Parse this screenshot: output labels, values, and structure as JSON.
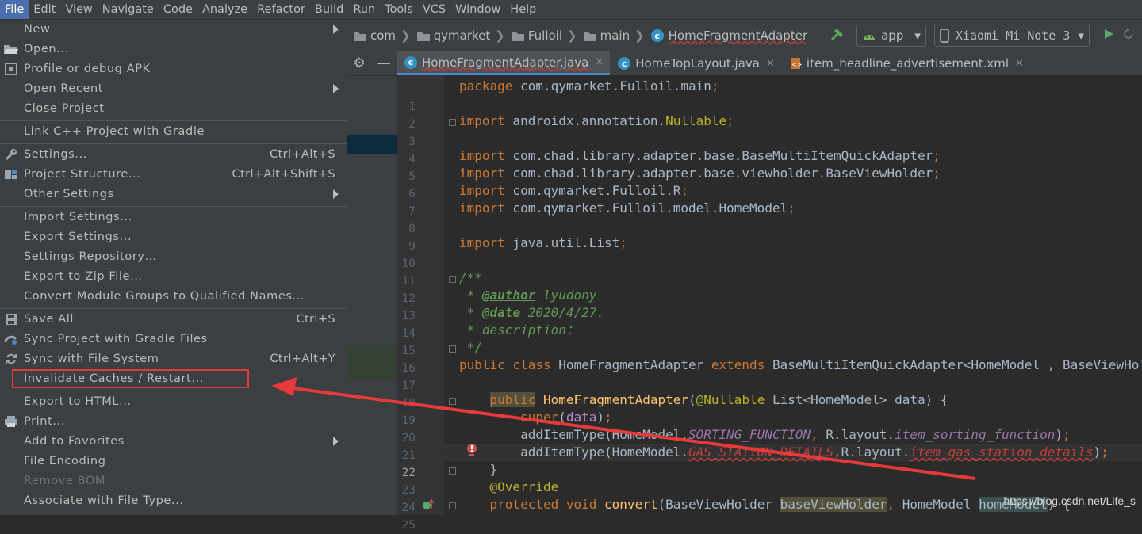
{
  "menubar": {
    "items": [
      "File",
      "Edit",
      "View",
      "Navigate",
      "Code",
      "Analyze",
      "Refactor",
      "Build",
      "Run",
      "Tools",
      "VCS",
      "Window",
      "Help"
    ],
    "active": "File"
  },
  "file_menu": {
    "items": [
      {
        "label": "New",
        "icon": "",
        "shortcut": "",
        "submenu": true
      },
      {
        "label": "Open...",
        "icon": "folder-icon",
        "shortcut": "",
        "submenu": false
      },
      {
        "label": "Profile or debug APK",
        "icon": "apk-icon",
        "shortcut": "",
        "submenu": false
      },
      {
        "label": "Open Recent",
        "icon": "",
        "shortcut": "",
        "submenu": true
      },
      {
        "label": "Close Project",
        "icon": "",
        "shortcut": "",
        "submenu": false
      },
      {
        "label": "Link C++ Project with Gradle",
        "icon": "",
        "shortcut": "",
        "submenu": false
      },
      {
        "label": "Settings...",
        "icon": "wrench-icon",
        "shortcut": "Ctrl+Alt+S",
        "submenu": false
      },
      {
        "label": "Project Structure...",
        "icon": "project-structure-icon",
        "shortcut": "Ctrl+Alt+Shift+S",
        "submenu": false
      },
      {
        "label": "Other Settings",
        "icon": "",
        "shortcut": "",
        "submenu": true
      },
      {
        "label": "Import Settings...",
        "icon": "",
        "shortcut": "",
        "submenu": false
      },
      {
        "label": "Export Settings...",
        "icon": "",
        "shortcut": "",
        "submenu": false
      },
      {
        "label": "Settings Repository…",
        "icon": "",
        "shortcut": "",
        "submenu": false
      },
      {
        "label": "Export to Zip File...",
        "icon": "",
        "shortcut": "",
        "submenu": false
      },
      {
        "label": "Convert Module Groups to Qualified Names...",
        "icon": "",
        "shortcut": "",
        "submenu": false
      },
      {
        "label": "Save All",
        "icon": "save-icon",
        "shortcut": "Ctrl+S",
        "submenu": false
      },
      {
        "label": "Sync Project with Gradle Files",
        "icon": "gradle-sync-icon",
        "shortcut": "",
        "submenu": false
      },
      {
        "label": "Sync with File System",
        "icon": "sync-icon",
        "shortcut": "Ctrl+Alt+Y",
        "submenu": false
      },
      {
        "label": "Invalidate Caches / Restart...",
        "icon": "",
        "shortcut": "",
        "submenu": false
      },
      {
        "label": "Export to HTML...",
        "icon": "",
        "shortcut": "",
        "submenu": false
      },
      {
        "label": "Print...",
        "icon": "printer-icon",
        "shortcut": "",
        "submenu": false
      },
      {
        "label": "Add to Favorites",
        "icon": "",
        "shortcut": "",
        "submenu": true
      },
      {
        "label": "File Encoding",
        "icon": "",
        "shortcut": "",
        "submenu": false
      },
      {
        "label": "Remove BOM",
        "icon": "",
        "shortcut": "",
        "submenu": false,
        "disabled": true
      },
      {
        "label": "Associate with File Type...",
        "icon": "",
        "shortcut": "",
        "submenu": false
      }
    ],
    "highlighted": "Invalidate Caches / Restart..."
  },
  "breadcrumb": [
    "com",
    "qymarket",
    "Fulloil",
    "main",
    "HomeFragmentAdapter"
  ],
  "toolbar": {
    "run_config": "app",
    "device": "Xiaomi Mi Note 3"
  },
  "tabs": [
    {
      "label": "HomeFragmentAdapter.java",
      "type": "java",
      "active": true
    },
    {
      "label": "HomeTopLayout.java",
      "type": "java",
      "active": false
    },
    {
      "label": "item_headline_advertisement.xml",
      "type": "xml",
      "active": false
    }
  ],
  "editor": {
    "line_numbers": [
      "",
      "1",
      "2",
      "3",
      "4",
      "5",
      "6",
      "7",
      "8",
      "9",
      "10",
      "11",
      "12",
      "13",
      "14",
      "15",
      "16",
      "17",
      "18",
      "19",
      "20",
      "21",
      "22",
      "23",
      "24",
      "25"
    ],
    "current_line": "22"
  },
  "colors": {
    "accent": "#4b6eaf",
    "highlight_border": "#e03b3b",
    "arrow": "#e83a3a"
  },
  "watermark": "https://blog.csdn.net/Life_s"
}
